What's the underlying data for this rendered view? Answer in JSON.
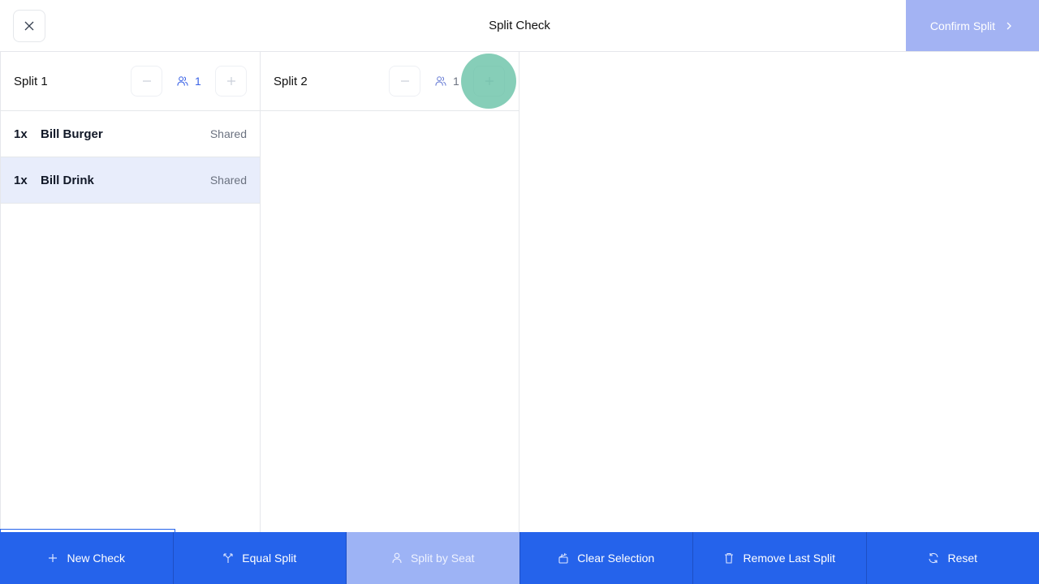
{
  "header": {
    "title": "Split Check",
    "close_icon": "close-icon",
    "confirm_label": "Confirm Split",
    "confirm_color": "#a3b3f3"
  },
  "splits": [
    {
      "title": "Split 1",
      "seat_count": "1",
      "items": [
        {
          "qty": "1x",
          "name": "Bill Burger",
          "tag": "Shared",
          "selected": false
        },
        {
          "qty": "1x",
          "name": "Bill Drink",
          "tag": "Shared",
          "selected": true
        }
      ]
    },
    {
      "title": "Split 2",
      "seat_count": "1",
      "items": []
    }
  ],
  "toolbar": {
    "new_check": "New Check",
    "equal_split": "Equal Split",
    "split_by_seat": "Split by Seat",
    "clear_selection": "Clear Selection",
    "remove_last_split": "Remove Last Split",
    "reset": "Reset",
    "active": "split_by_seat",
    "color": "#2563eb"
  }
}
